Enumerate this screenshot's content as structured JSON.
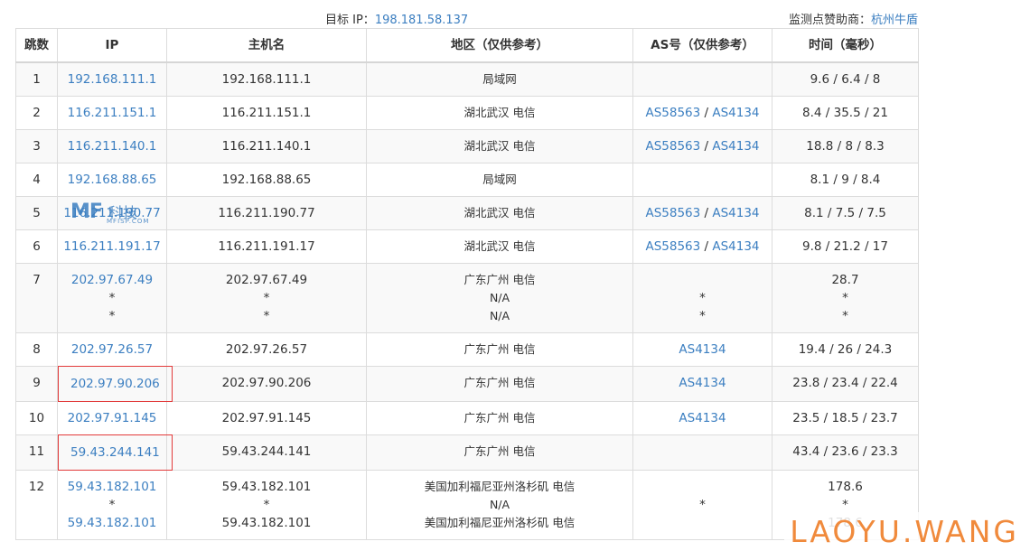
{
  "header": {
    "target_label": "目标 IP：",
    "target_ip": "198.181.58.137",
    "sponsor_label": "监测点赞助商：",
    "sponsor_name": "杭州牛盾"
  },
  "table": {
    "columns": [
      "跳数",
      "IP",
      "主机名",
      "地区（仅供参考）",
      "AS号（仅供参考）",
      "时间（毫秒）"
    ],
    "rows": [
      {
        "hop": "1",
        "ip": [
          "192.168.111.1"
        ],
        "host": [
          "192.168.111.1"
        ],
        "region": [
          "局域网"
        ],
        "as": [
          []
        ],
        "time": [
          "9.6 / 6.4 / 8"
        ]
      },
      {
        "hop": "2",
        "ip": [
          "116.211.151.1"
        ],
        "host": [
          "116.211.151.1"
        ],
        "region": [
          "湖北武汉 电信"
        ],
        "as": [
          [
            "AS58563",
            "AS4134"
          ]
        ],
        "time": [
          "8.4 / 35.5 / 21"
        ]
      },
      {
        "hop": "3",
        "ip": [
          "116.211.140.1"
        ],
        "host": [
          "116.211.140.1"
        ],
        "region": [
          "湖北武汉 电信"
        ],
        "as": [
          [
            "AS58563",
            "AS4134"
          ]
        ],
        "time": [
          "18.8 / 8 / 8.3"
        ]
      },
      {
        "hop": "4",
        "ip": [
          "192.168.88.65"
        ],
        "host": [
          "192.168.88.65"
        ],
        "region": [
          "局域网"
        ],
        "as": [
          []
        ],
        "time": [
          "8.1 / 9 / 8.4"
        ]
      },
      {
        "hop": "5",
        "ip": [
          "116.211.190.77"
        ],
        "host": [
          "116.211.190.77"
        ],
        "region": [
          "湖北武汉 电信"
        ],
        "as": [
          [
            "AS58563",
            "AS4134"
          ]
        ],
        "time": [
          "8.1 / 7.5 / 7.5"
        ]
      },
      {
        "hop": "6",
        "ip": [
          "116.211.191.17"
        ],
        "host": [
          "116.211.191.17"
        ],
        "region": [
          "湖北武汉 电信"
        ],
        "as": [
          [
            "AS58563",
            "AS4134"
          ]
        ],
        "time": [
          "9.8 / 21.2 / 17"
        ]
      },
      {
        "hop": "7",
        "ip": [
          "202.97.67.49",
          "*",
          "*"
        ],
        "host": [
          "202.97.67.49",
          "*",
          "*"
        ],
        "region": [
          "广东广州 电信",
          "N/A",
          "N/A"
        ],
        "as": [
          [],
          [
            "*"
          ],
          [
            "*"
          ]
        ],
        "time": [
          "28.7",
          "*",
          "*"
        ]
      },
      {
        "hop": "8",
        "ip": [
          "202.97.26.57"
        ],
        "host": [
          "202.97.26.57"
        ],
        "region": [
          "广东广州 电信"
        ],
        "as": [
          [
            "AS4134"
          ]
        ],
        "time": [
          "19.4 / 26 / 24.3"
        ]
      },
      {
        "hop": "9",
        "ip": [
          "202.97.90.206"
        ],
        "highlight": true,
        "host": [
          "202.97.90.206"
        ],
        "region": [
          "广东广州 电信"
        ],
        "as": [
          [
            "AS4134"
          ]
        ],
        "time": [
          "23.8 / 23.4 / 22.4"
        ]
      },
      {
        "hop": "10",
        "ip": [
          "202.97.91.145"
        ],
        "host": [
          "202.97.91.145"
        ],
        "region": [
          "广东广州 电信"
        ],
        "as": [
          [
            "AS4134"
          ]
        ],
        "time": [
          "23.5 / 18.5 / 23.7"
        ]
      },
      {
        "hop": "11",
        "ip": [
          "59.43.244.141"
        ],
        "highlight": true,
        "host": [
          "59.43.244.141"
        ],
        "region": [
          "广东广州 电信"
        ],
        "as": [
          []
        ],
        "time": [
          "43.4 / 23.6 / 23.3"
        ]
      },
      {
        "hop": "12",
        "ip": [
          "59.43.182.101",
          "*",
          "59.43.182.101"
        ],
        "host": [
          "59.43.182.101",
          "*",
          "59.43.182.101"
        ],
        "region": [
          "美国加利福尼亚州洛杉矶 电信",
          "N/A",
          "美国加利福尼亚州洛杉矶 电信"
        ],
        "as": [
          [],
          [
            "*"
          ],
          []
        ],
        "time": [
          "178.6",
          "*",
          "178.6"
        ]
      }
    ]
  },
  "watermarks": {
    "mf_logo": "MF",
    "mf_text": "科技",
    "mf_sub": "MFISP.COM",
    "laoyu": "LAOYU.WANG"
  },
  "colors": {
    "link": "#3c7fc1",
    "highlight_border": "#e23a3a",
    "laoyu": "#f08a3c"
  }
}
